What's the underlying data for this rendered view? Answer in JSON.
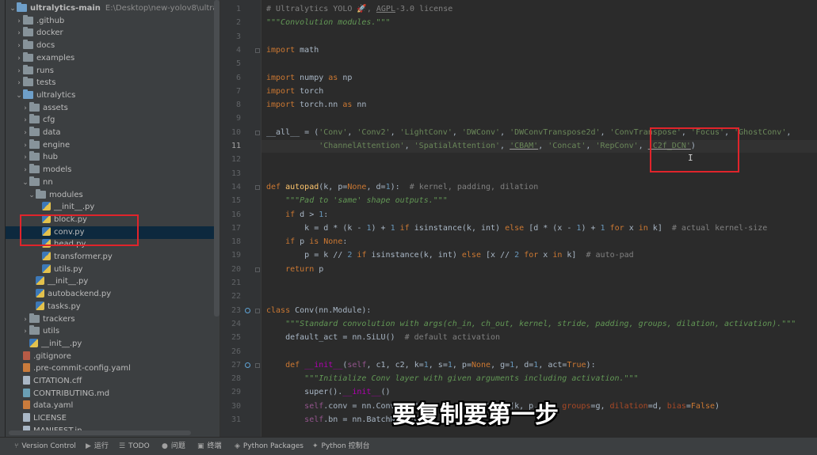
{
  "project": {
    "root_name": "ultralytics-main",
    "root_path": "E:\\Desktop\\new-yolov8\\ultralytics"
  },
  "tree": [
    {
      "label": "ultralytics-main",
      "indent": 0,
      "arrow": "down",
      "icon": "folder",
      "selected": false
    },
    {
      "label": ".github",
      "indent": 1,
      "arrow": "right",
      "icon": "folder"
    },
    {
      "label": "docker",
      "indent": 1,
      "arrow": "right",
      "icon": "folder"
    },
    {
      "label": "docs",
      "indent": 1,
      "arrow": "right",
      "icon": "folder"
    },
    {
      "label": "examples",
      "indent": 1,
      "arrow": "right",
      "icon": "folder"
    },
    {
      "label": "runs",
      "indent": 1,
      "arrow": "right",
      "icon": "folder"
    },
    {
      "label": "tests",
      "indent": 1,
      "arrow": "right",
      "icon": "folder"
    },
    {
      "label": "ultralytics",
      "indent": 1,
      "arrow": "down",
      "icon": "folder"
    },
    {
      "label": "assets",
      "indent": 2,
      "arrow": "right",
      "icon": "folder"
    },
    {
      "label": "cfg",
      "indent": 2,
      "arrow": "right",
      "icon": "folder"
    },
    {
      "label": "data",
      "indent": 2,
      "arrow": "right",
      "icon": "folder"
    },
    {
      "label": "engine",
      "indent": 2,
      "arrow": "right",
      "icon": "folder"
    },
    {
      "label": "hub",
      "indent": 2,
      "arrow": "right",
      "icon": "folder"
    },
    {
      "label": "models",
      "indent": 2,
      "arrow": "right",
      "icon": "folder"
    },
    {
      "label": "nn",
      "indent": 2,
      "arrow": "down",
      "icon": "folder"
    },
    {
      "label": "modules",
      "indent": 3,
      "arrow": "down",
      "icon": "folder"
    },
    {
      "label": "__init__.py",
      "indent": 4,
      "arrow": "none",
      "icon": "py"
    },
    {
      "label": "block.py",
      "indent": 4,
      "arrow": "none",
      "icon": "py"
    },
    {
      "label": "conv.py",
      "indent": 4,
      "arrow": "none",
      "icon": "py",
      "selected": true
    },
    {
      "label": "head.py",
      "indent": 4,
      "arrow": "none",
      "icon": "py"
    },
    {
      "label": "transformer.py",
      "indent": 4,
      "arrow": "none",
      "icon": "py"
    },
    {
      "label": "utils.py",
      "indent": 4,
      "arrow": "none",
      "icon": "py"
    },
    {
      "label": "__init__.py",
      "indent": 3,
      "arrow": "none",
      "icon": "py"
    },
    {
      "label": "autobackend.py",
      "indent": 3,
      "arrow": "none",
      "icon": "py"
    },
    {
      "label": "tasks.py",
      "indent": 3,
      "arrow": "none",
      "icon": "py"
    },
    {
      "label": "trackers",
      "indent": 2,
      "arrow": "right",
      "icon": "folder"
    },
    {
      "label": "utils",
      "indent": 2,
      "arrow": "right",
      "icon": "folder"
    },
    {
      "label": "__init__.py",
      "indent": 2,
      "arrow": "none",
      "icon": "py"
    },
    {
      "label": ".gitignore",
      "indent": 1,
      "arrow": "none",
      "icon": "git"
    },
    {
      "label": ".pre-commit-config.yaml",
      "indent": 1,
      "arrow": "none",
      "icon": "yaml"
    },
    {
      "label": "CITATION.cff",
      "indent": 1,
      "arrow": "none",
      "icon": "file"
    },
    {
      "label": "CONTRIBUTING.md",
      "indent": 1,
      "arrow": "none",
      "icon": "md"
    },
    {
      "label": "data.yaml",
      "indent": 1,
      "arrow": "none",
      "icon": "yaml"
    },
    {
      "label": "LICENSE",
      "indent": 1,
      "arrow": "none",
      "icon": "file"
    },
    {
      "label": "MANIFEST.in",
      "indent": 1,
      "arrow": "none",
      "icon": "file"
    }
  ],
  "editor": {
    "file": "conv.py",
    "current_line": 11,
    "gutter_marks": [
      23,
      27
    ],
    "lines": [
      {
        "n": 1,
        "t": [
          [
            "com",
            "# Ultralytics YOLO 🚀, "
          ],
          [
            "link",
            "AGPL"
          ],
          [
            "com",
            "-3.0 license"
          ]
        ]
      },
      {
        "n": 2,
        "t": [
          [
            "doc",
            "\"\"\"Convolution modules.\"\"\""
          ]
        ]
      },
      {
        "n": 3,
        "t": []
      },
      {
        "n": 4,
        "t": [
          [
            "kw",
            "import"
          ],
          [
            "",
            " math"
          ]
        ]
      },
      {
        "n": 5,
        "t": []
      },
      {
        "n": 6,
        "t": [
          [
            "kw",
            "import"
          ],
          [
            "",
            " numpy "
          ],
          [
            "kw",
            "as"
          ],
          [
            "",
            " np"
          ]
        ]
      },
      {
        "n": 7,
        "t": [
          [
            "kw",
            "import"
          ],
          [
            "",
            " torch"
          ]
        ]
      },
      {
        "n": 8,
        "t": [
          [
            "kw",
            "import"
          ],
          [
            "",
            " torch.nn "
          ],
          [
            "kw",
            "as"
          ],
          [
            "",
            " nn"
          ]
        ]
      },
      {
        "n": 9,
        "t": []
      },
      {
        "n": 10,
        "t": [
          [
            "",
            "__all__ = ("
          ],
          [
            "str",
            "'Conv'"
          ],
          [
            "",
            ", "
          ],
          [
            "str",
            "'Conv2'"
          ],
          [
            "",
            ", "
          ],
          [
            "str",
            "'LightConv'"
          ],
          [
            "",
            ", "
          ],
          [
            "str",
            "'DWConv'"
          ],
          [
            "",
            ", "
          ],
          [
            "str",
            "'DWConvTranspose2d'"
          ],
          [
            "",
            ", "
          ],
          [
            "str",
            "'ConvTranspose'"
          ],
          [
            "",
            ", "
          ],
          [
            "str",
            "'Focus'"
          ],
          [
            "",
            ", "
          ],
          [
            "str",
            "'GhostConv'"
          ],
          [
            "",
            ","
          ]
        ]
      },
      {
        "n": 11,
        "t": [
          [
            "",
            "           "
          ],
          [
            "str",
            "'ChannelAttention'"
          ],
          [
            "",
            ", "
          ],
          [
            "str",
            "'SpatialAttention'"
          ],
          [
            "",
            ", "
          ],
          [
            "str",
            "'CBAM'"
          ],
          [
            "",
            ", "
          ],
          [
            "str",
            "'Concat'"
          ],
          [
            "",
            ", "
          ],
          [
            "str",
            "'RepConv'"
          ],
          [
            "",
            ", "
          ],
          [
            "str",
            "'C2f_DCN'"
          ],
          [
            "",
            ")"
          ]
        ]
      },
      {
        "n": 12,
        "t": []
      },
      {
        "n": 13,
        "t": []
      },
      {
        "n": 14,
        "t": [
          [
            "kw",
            "def "
          ],
          [
            "fn",
            "autopad"
          ],
          [
            "",
            "(k, p="
          ],
          [
            "kw",
            "None"
          ],
          [
            "",
            ", d="
          ],
          [
            "num",
            "1"
          ],
          [
            "",
            "):  "
          ],
          [
            "com",
            "# kernel, padding, dilation"
          ]
        ]
      },
      {
        "n": 15,
        "t": [
          [
            "",
            "    "
          ],
          [
            "doc",
            "\"\"\"Pad to 'same' shape outputs.\"\"\""
          ]
        ]
      },
      {
        "n": 16,
        "t": [
          [
            "",
            "    "
          ],
          [
            "kw",
            "if"
          ],
          [
            "",
            " d > "
          ],
          [
            "num",
            "1"
          ],
          [
            "",
            ":"
          ]
        ]
      },
      {
        "n": 17,
        "t": [
          [
            "",
            "        k = d * (k - "
          ],
          [
            "num",
            "1"
          ],
          [
            "",
            ") + "
          ],
          [
            "num",
            "1"
          ],
          [
            "",
            " "
          ],
          [
            "kw",
            "if"
          ],
          [
            "",
            " isinstance(k, int) "
          ],
          [
            "kw",
            "else"
          ],
          [
            "",
            " [d * (x - "
          ],
          [
            "num",
            "1"
          ],
          [
            "",
            ") + "
          ],
          [
            "num",
            "1"
          ],
          [
            "",
            " "
          ],
          [
            "kw",
            "for"
          ],
          [
            "",
            " x "
          ],
          [
            "kw",
            "in"
          ],
          [
            "",
            " k]  "
          ],
          [
            "com",
            "# actual kernel-size"
          ]
        ]
      },
      {
        "n": 18,
        "t": [
          [
            "",
            "    "
          ],
          [
            "kw",
            "if"
          ],
          [
            "",
            " p "
          ],
          [
            "kw",
            "is None"
          ],
          [
            "",
            ":"
          ]
        ]
      },
      {
        "n": 19,
        "t": [
          [
            "",
            "        p = k // "
          ],
          [
            "num",
            "2"
          ],
          [
            "",
            " "
          ],
          [
            "kw",
            "if"
          ],
          [
            "",
            " isinstance(k, int) "
          ],
          [
            "kw",
            "else"
          ],
          [
            "",
            " [x // "
          ],
          [
            "num",
            "2"
          ],
          [
            "",
            " "
          ],
          [
            "kw",
            "for"
          ],
          [
            "",
            " x "
          ],
          [
            "kw",
            "in"
          ],
          [
            "",
            " k]  "
          ],
          [
            "com",
            "# auto-pad"
          ]
        ]
      },
      {
        "n": 20,
        "t": [
          [
            "",
            "    "
          ],
          [
            "kw",
            "return"
          ],
          [
            "",
            " p"
          ]
        ]
      },
      {
        "n": 21,
        "t": []
      },
      {
        "n": 22,
        "t": []
      },
      {
        "n": 23,
        "t": [
          [
            "kw",
            "class "
          ],
          [
            "",
            "Conv(nn.Module):"
          ]
        ]
      },
      {
        "n": 24,
        "t": [
          [
            "",
            "    "
          ],
          [
            "doc",
            "\"\"\"Standard convolution with args(ch_in, ch_out, kernel, stride, padding, groups, dilation, activation).\"\"\""
          ]
        ]
      },
      {
        "n": 25,
        "t": [
          [
            "",
            "    default_act = nn.SiLU()  "
          ],
          [
            "com",
            "# default activation"
          ]
        ]
      },
      {
        "n": 26,
        "t": []
      },
      {
        "n": 27,
        "t": [
          [
            "",
            "    "
          ],
          [
            "kw",
            "def "
          ],
          [
            "magic",
            "__init__"
          ],
          [
            "",
            "("
          ],
          [
            "self",
            "self"
          ],
          [
            "",
            ", c1, c2, k="
          ],
          [
            "num",
            "1"
          ],
          [
            "",
            ", s="
          ],
          [
            "num",
            "1"
          ],
          [
            "",
            ", p="
          ],
          [
            "kw",
            "None"
          ],
          [
            "",
            ", g="
          ],
          [
            "num",
            "1"
          ],
          [
            "",
            ", d="
          ],
          [
            "num",
            "1"
          ],
          [
            "",
            ", act="
          ],
          [
            "kw",
            "True"
          ],
          [
            "",
            "):"
          ]
        ]
      },
      {
        "n": 28,
        "t": [
          [
            "",
            "        "
          ],
          [
            "doc",
            "\"\"\"Initialize Conv layer with given arguments including activation.\"\"\""
          ]
        ]
      },
      {
        "n": 29,
        "t": [
          [
            "",
            "        super()."
          ],
          [
            "magic",
            "__init__"
          ],
          [
            "",
            "()"
          ]
        ]
      },
      {
        "n": 30,
        "t": [
          [
            "",
            "        "
          ],
          [
            "self",
            "self"
          ],
          [
            "",
            ".conv = nn.Conv2d(c1, c2, k, s, autopad(k, p, d), "
          ],
          [
            "param",
            "groups"
          ],
          [
            "",
            "=g, "
          ],
          [
            "param",
            "dilation"
          ],
          [
            "",
            "=d, "
          ],
          [
            "param",
            "bias"
          ],
          [
            "",
            "="
          ],
          [
            "kw",
            "False"
          ],
          [
            "",
            ")"
          ]
        ]
      },
      {
        "n": 31,
        "t": [
          [
            "",
            "        "
          ],
          [
            "self",
            "self"
          ],
          [
            "",
            ".bn = nn.BatchNorm2d(c2)"
          ]
        ]
      }
    ]
  },
  "subtitle": "要复制要第一步",
  "status_bar": {
    "tabs": [
      {
        "icon": "git-branch-icon",
        "glyph": "⑂",
        "label": "Version Control"
      },
      {
        "icon": "run-icon",
        "glyph": "▶",
        "label": "运行"
      },
      {
        "icon": "todo-icon",
        "glyph": "☰",
        "label": "TODO"
      },
      {
        "icon": "problems-icon",
        "glyph": "●",
        "label": "问题"
      },
      {
        "icon": "terminal-icon",
        "glyph": "▣",
        "label": "终端"
      },
      {
        "icon": "packages-icon",
        "glyph": "◈",
        "label": "Python Packages"
      },
      {
        "icon": "console-icon",
        "glyph": "✦",
        "label": "Python 控制台"
      }
    ]
  },
  "colors": {
    "panel": "#3c3f41",
    "editor_bg": "#2b2b2b",
    "annotation_red": "#e0242b"
  }
}
